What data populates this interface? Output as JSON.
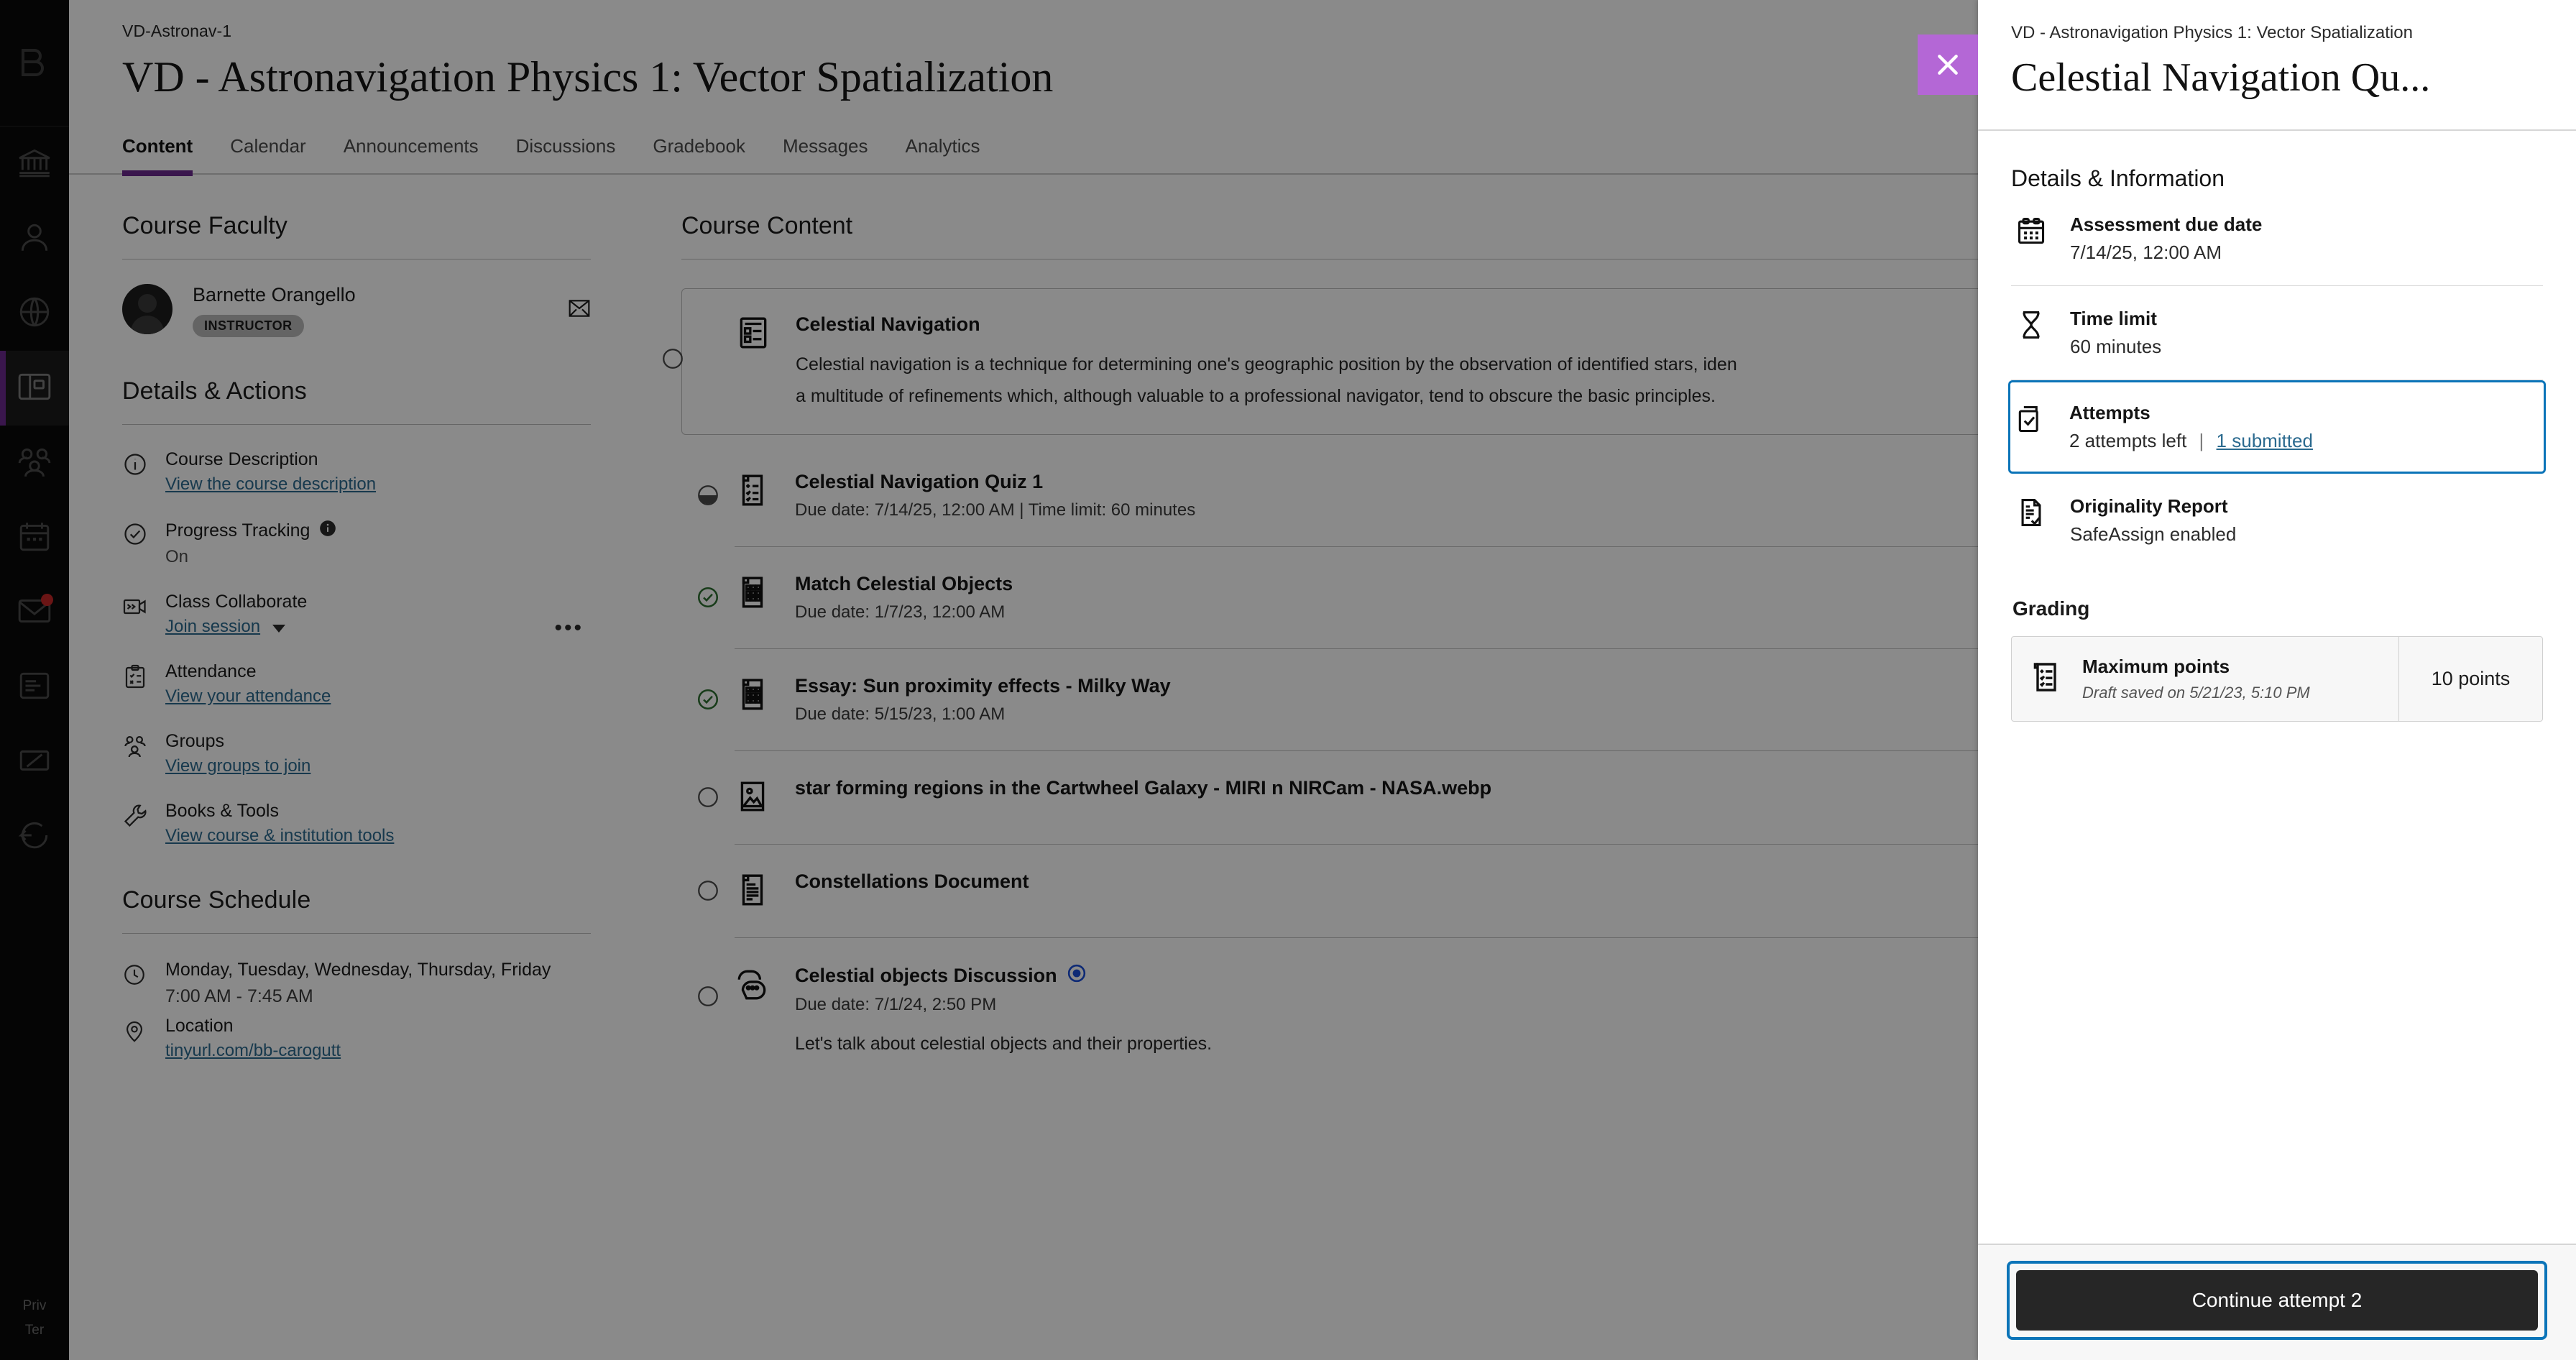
{
  "leftnav": {
    "brand_icon": "blackboard-logo-icon",
    "items": [
      {
        "name": "institution-page",
        "icon": "institution-icon",
        "badge": false,
        "active": false
      },
      {
        "name": "profile",
        "icon": "person-icon",
        "badge": false,
        "active": false
      },
      {
        "name": "activity-stream",
        "icon": "globe-icon",
        "badge": false,
        "active": false
      },
      {
        "name": "courses",
        "icon": "courses-icon",
        "badge": false,
        "active": true
      },
      {
        "name": "organizations",
        "icon": "groups-icon",
        "badge": false,
        "active": false
      },
      {
        "name": "calendar",
        "icon": "calendar-icon",
        "badge": false,
        "active": false
      },
      {
        "name": "messages",
        "icon": "envelope-icon",
        "badge": true,
        "active": false
      },
      {
        "name": "grades",
        "icon": "grades-icon",
        "badge": false,
        "active": false
      },
      {
        "name": "tools",
        "icon": "tools-icon",
        "badge": false,
        "active": false
      },
      {
        "name": "sign-out",
        "icon": "sign-out-icon",
        "badge": false,
        "active": false
      }
    ],
    "legal": {
      "privacy": "Priv",
      "terms": "Ter"
    }
  },
  "course": {
    "id": "VD-Astronav-1",
    "title": "VD - Astronavigation Physics 1: Vector Spatialization",
    "tabs": [
      {
        "label": "Content",
        "active": true
      },
      {
        "label": "Calendar",
        "active": false
      },
      {
        "label": "Announcements",
        "active": false
      },
      {
        "label": "Discussions",
        "active": false
      },
      {
        "label": "Gradebook",
        "active": false
      },
      {
        "label": "Messages",
        "active": false
      },
      {
        "label": "Analytics",
        "active": false
      }
    ]
  },
  "faculty": {
    "heading": "Course Faculty",
    "name": "Barnette Orangello",
    "role": "INSTRUCTOR",
    "mail_icon": "envelope-icon"
  },
  "details_actions": {
    "heading": "Details & Actions",
    "items": [
      {
        "icon": "info-circle-icon",
        "label": "Course Description",
        "link": "View the course description",
        "sub": null,
        "info": false,
        "caret": false,
        "overflow": false
      },
      {
        "icon": "check-circle-icon",
        "label": "Progress Tracking",
        "link": null,
        "sub": "On",
        "info": true,
        "caret": false,
        "overflow": false
      },
      {
        "icon": "video-icon",
        "label": "Class Collaborate",
        "link": "Join session",
        "sub": null,
        "info": false,
        "caret": true,
        "overflow": true
      },
      {
        "icon": "clipboard-check-icon",
        "label": "Attendance",
        "link": "View your attendance",
        "sub": null,
        "info": false,
        "caret": false,
        "overflow": false
      },
      {
        "icon": "groups-icon",
        "label": "Groups",
        "link": "View groups to join",
        "sub": null,
        "info": false,
        "caret": false,
        "overflow": false
      },
      {
        "icon": "wrench-icon",
        "label": "Books & Tools",
        "link": "View course & institution tools",
        "sub": null,
        "info": false,
        "caret": false,
        "overflow": false
      }
    ]
  },
  "schedule": {
    "heading": "Course Schedule",
    "days": "Monday, Tuesday, Wednesday, Thursday, Friday",
    "time": "7:00 AM - 7:45 AM",
    "location_label": "Location",
    "location_link": "tinyurl.com/bb-carogutt"
  },
  "content": {
    "heading": "Course Content",
    "card_items": [
      {
        "status": "not-started",
        "icon": "module-icon",
        "title": "Celestial Navigation",
        "meta": null,
        "desc_line1": "Celestial navigation is a technique for determining one's geographic position by the observation of identified stars, iden",
        "desc_line2": "a multitude of refinements which, although valuable to a professional navigator, tend to obscure the basic principles.",
        "discussion_badge": false
      }
    ],
    "items": [
      {
        "status": "in-progress",
        "icon": "test-icon",
        "title": "Celestial Navigation Quiz 1",
        "meta": "Due date: 7/14/25, 12:00 AM  |  Time limit: 60 minutes",
        "desc": null,
        "discussion_badge": false
      },
      {
        "status": "complete",
        "icon": "assignment-icon",
        "title": "Match Celestial Objects",
        "meta": "Due date: 1/7/23, 12:00 AM",
        "desc": null,
        "discussion_badge": false
      },
      {
        "status": "complete",
        "icon": "assignment-icon",
        "title": "Essay: Sun proximity effects - Milky Way",
        "meta": "Due date: 5/15/23, 1:00 AM",
        "desc": null,
        "discussion_badge": false
      },
      {
        "status": "not-started",
        "icon": "image-icon",
        "title": "star forming regions in the Cartwheel Galaxy - MIRI n NIRCam - NASA.webp",
        "meta": null,
        "desc": null,
        "discussion_badge": false
      },
      {
        "status": "not-started",
        "icon": "document-icon",
        "title": "Constellations Document",
        "meta": null,
        "desc": null,
        "discussion_badge": false
      },
      {
        "status": "not-started",
        "icon": "discussion-icon",
        "title": "Celestial objects Discussion",
        "meta": "Due date: 7/1/24, 2:50 PM",
        "desc": "Let's talk about celestial objects and their properties.",
        "discussion_badge": true
      }
    ]
  },
  "panel": {
    "close_icon": "close-icon",
    "crumb": "VD - Astronavigation Physics 1: Vector Spatialization",
    "title": "Celestial Navigation Qu...",
    "details_heading": "Details & Information",
    "details": [
      {
        "icon": "calendar-icon",
        "label": "Assessment due date",
        "value": "7/14/25, 12:00 AM",
        "link": null,
        "focused": false
      },
      {
        "icon": "hourglass-icon",
        "label": "Time limit",
        "value": "60 minutes",
        "link": null,
        "focused": false
      },
      {
        "icon": "attempts-icon",
        "label": "Attempts",
        "value": "2 attempts left",
        "link": "1 submitted",
        "focused": true
      },
      {
        "icon": "originality-icon",
        "label": "Originality Report",
        "value": "SafeAssign enabled",
        "link": null,
        "focused": false
      }
    ],
    "grading_heading": "Grading",
    "grading": {
      "icon": "rubric-icon",
      "title": "Maximum points",
      "sub": "Draft saved on 5/21/23, 5:10 PM",
      "points": "10 points"
    },
    "cta_label": "Continue attempt 2"
  },
  "colors": {
    "accent_purple": "#6c2a8e",
    "close_purple": "#b467d6",
    "focus_blue": "#0b74b8",
    "link_blue": "#2b6a8f",
    "complete_green": "#2e7031",
    "cta_dark": "#262626",
    "badge_red": "#c62828"
  }
}
